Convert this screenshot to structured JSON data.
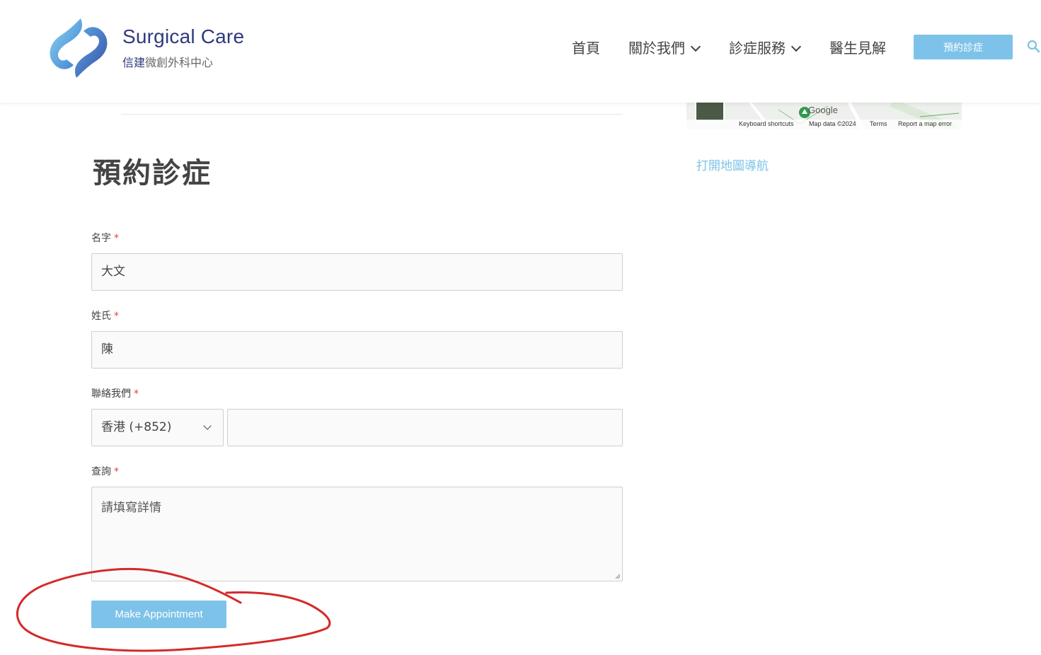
{
  "header": {
    "brand_title": "Surgical Care",
    "brand_sub_accent": "信建",
    "brand_sub_rest": "微創外科中心",
    "nav": [
      {
        "label": "首頁",
        "has_dropdown": false
      },
      {
        "label": "關於我們",
        "has_dropdown": true
      },
      {
        "label": "診症服務",
        "has_dropdown": true
      },
      {
        "label": "醫生見解",
        "has_dropdown": false
      }
    ],
    "cta_label": "預約診症"
  },
  "map": {
    "google": "Google",
    "keyboard_shortcuts": "Keyboard shortcuts",
    "map_data": "Map data ©2024",
    "terms": "Terms",
    "report": "Report a map error",
    "open_nav_link": "打開地圖導航"
  },
  "form": {
    "title": "預約診症",
    "first_name": {
      "label": "名字",
      "value": "大文"
    },
    "last_name": {
      "label": "姓氏",
      "value": "陳"
    },
    "contact": {
      "label": "聯絡我們",
      "country_selected": "香港 (+852)",
      "phone_value": ""
    },
    "inquiry": {
      "label": "查詢",
      "placeholder": "請填寫詳情"
    },
    "required_mark": "*",
    "submit_label": "Make Appointment"
  },
  "colors": {
    "brand_navy": "#2f3a7c",
    "accent_blue": "#7dc2e8",
    "required_red": "#e0433e",
    "annotation_red": "#d42a2a"
  }
}
